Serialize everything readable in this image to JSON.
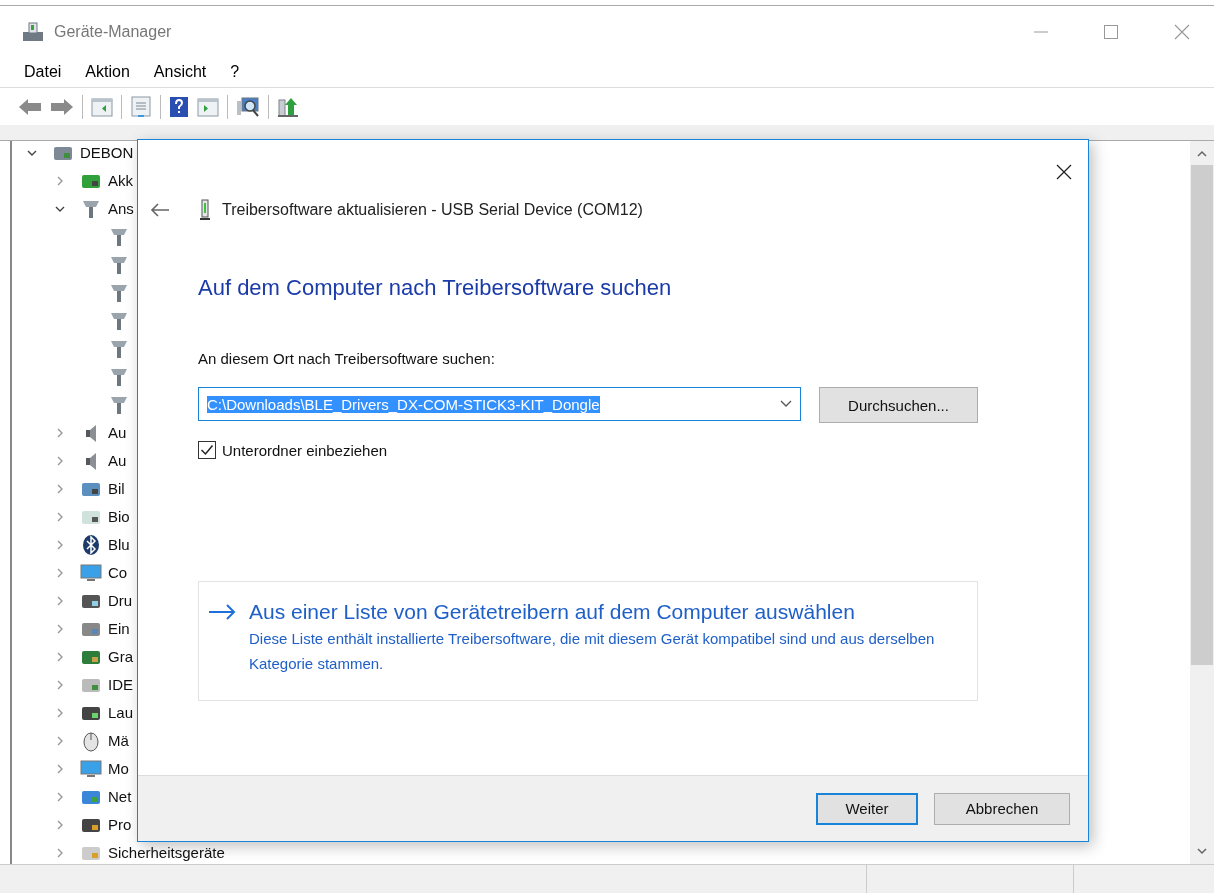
{
  "window": {
    "title": "Geräte-Manager"
  },
  "menu": [
    "Datei",
    "Aktion",
    "Ansicht",
    "?"
  ],
  "tree": {
    "items": [
      {
        "label": "DEBON",
        "kind": "computer",
        "expanded": true,
        "children": [
          {
            "label": "Akk",
            "kind": "battery",
            "expanded": false
          },
          {
            "label": "Ans",
            "kind": "port",
            "expanded": true,
            "children": [
              {
                "kind": "port"
              },
              {
                "kind": "port"
              },
              {
                "kind": "port"
              },
              {
                "kind": "port"
              },
              {
                "kind": "port"
              },
              {
                "kind": "port"
              },
              {
                "kind": "port"
              }
            ]
          },
          {
            "label": "Au",
            "kind": "audio",
            "expanded": false
          },
          {
            "label": "Au",
            "kind": "audio",
            "expanded": false
          },
          {
            "label": "Bil",
            "kind": "camera",
            "expanded": false
          },
          {
            "label": "Bio",
            "kind": "fingerprint",
            "expanded": false
          },
          {
            "label": "Blu",
            "kind": "bluetooth",
            "expanded": false
          },
          {
            "label": "Co",
            "kind": "monitor",
            "expanded": false
          },
          {
            "label": "Dru",
            "kind": "printer",
            "expanded": false
          },
          {
            "label": "Ein",
            "kind": "input",
            "expanded": false
          },
          {
            "label": "Gra",
            "kind": "card",
            "expanded": false
          },
          {
            "label": "IDE",
            "kind": "ide",
            "expanded": false
          },
          {
            "label": "Lau",
            "kind": "drive",
            "expanded": false
          },
          {
            "label": "Mä",
            "kind": "mouse",
            "expanded": false
          },
          {
            "label": "Mo",
            "kind": "monitor",
            "expanded": false
          },
          {
            "label": "Net",
            "kind": "network",
            "expanded": false
          },
          {
            "label": "Pro",
            "kind": "processor",
            "expanded": false
          },
          {
            "label": "Sicherheitsgeräte",
            "kind": "security",
            "expanded": false
          }
        ]
      }
    ]
  },
  "dialog": {
    "title": "Treibersoftware aktualisieren - USB Serial Device (COM12)",
    "heading": "Auf dem Computer nach Treibersoftware suchen",
    "location_label": "An diesem Ort nach Treibersoftware suchen:",
    "path": {
      "value": "C:\\Downloads\\BLE_Drivers_DX-COM-STICK3-KIT_Dongle",
      "highlighted": true
    },
    "browse_button": "Durchsuchen...",
    "include_subfolders": {
      "label": "Unterordner einbeziehen",
      "checked": true
    },
    "option": {
      "title": "Aus einer Liste von Gerätetreibern auf dem Computer auswählen",
      "description": "Diese Liste enthält installierte Treibersoftware, die mit diesem Gerät kompatibel sind und aus derselben Kategorie stammen."
    },
    "buttons": [
      {
        "label": "Weiter",
        "default": true
      },
      {
        "label": "Abbrechen",
        "default": false
      }
    ]
  }
}
